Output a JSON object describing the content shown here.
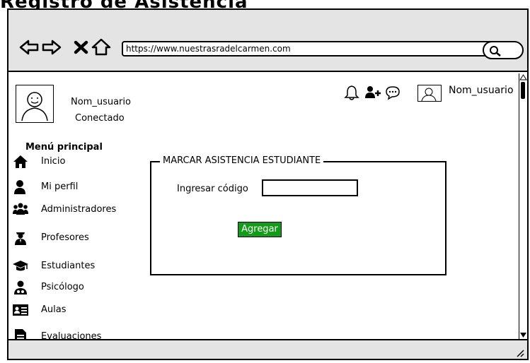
{
  "page_heading": "Registro de Asistencia",
  "browser": {
    "url": "https://www.nuestrasradelcarmen.com",
    "icons": [
      "back-icon",
      "forward-icon",
      "close-icon",
      "home-icon",
      "search-icon"
    ]
  },
  "profile": {
    "name": "Nom_usuario",
    "status": "Conectado"
  },
  "top_bar": {
    "user_name": "Nom_usuario",
    "icons": [
      "bell-icon",
      "add-user-icon",
      "chat-icon",
      "avatar"
    ]
  },
  "menu": {
    "title": "Menú principal",
    "items": [
      {
        "label": "Inicio",
        "icon": "home-icon"
      },
      {
        "label": "Mi perfil",
        "icon": "user-icon"
      },
      {
        "label": "Administradores",
        "icon": "users-icon"
      },
      {
        "label": "Profesores",
        "icon": "teacher-icon"
      },
      {
        "label": "Estudiantes",
        "icon": "graduation-cap-icon"
      },
      {
        "label": "Psicólogo",
        "icon": "doctor-icon"
      },
      {
        "label": "Aulas",
        "icon": "classroom-icon"
      },
      {
        "label": "Evaluaciones",
        "icon": "document-icon"
      }
    ]
  },
  "panel": {
    "title": "MARCAR ASISTENCIA ESTUDIANTE",
    "code_label": "Ingresar código",
    "code_value": "",
    "button_label": "Agregar"
  },
  "colors": {
    "accent": "#159b1a",
    "chrome": "#e4e4e4"
  }
}
